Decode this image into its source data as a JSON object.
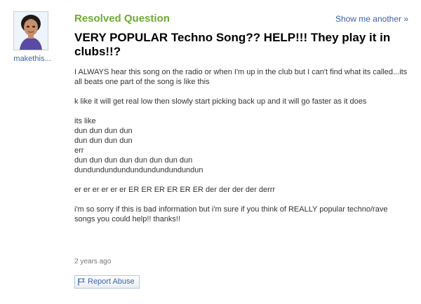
{
  "asker": {
    "username": "makethis...",
    "avatar": "cartoon-avatar-icon"
  },
  "header": {
    "status_label": "Resolved Question",
    "show_another_label": "Show me another »"
  },
  "question": {
    "title": "VERY POPULAR Techno Song?? HELP!!! They play it in clubs!!?",
    "body_paragraphs": [
      "I ALWAYS hear this song on the radio or when I'm up in the club but I can't find what its called...its all beats one part of the song is like this",
      "k like it will get real low then slowly start picking back up and it will go faster as it does",
      "its like",
      "dun dun dun dun",
      "dun dun dun dun",
      "err",
      "dun dun dun dun dun dun dun dun",
      "dundundundundundundundundundun",
      "er er er er er er ER ER ER ER ER ER der der der der derrr",
      "i'm so sorry if this is bad information but i'm sure if you think of REALLY popular techno/rave songs you could help!! thanks!!"
    ],
    "timestamp": "2 years ago"
  },
  "actions": {
    "report_label": "Report Abuse",
    "report_icon": "flag-icon"
  },
  "colors": {
    "resolved_green": "#6eab2f",
    "link_blue": "#3a63a8"
  }
}
